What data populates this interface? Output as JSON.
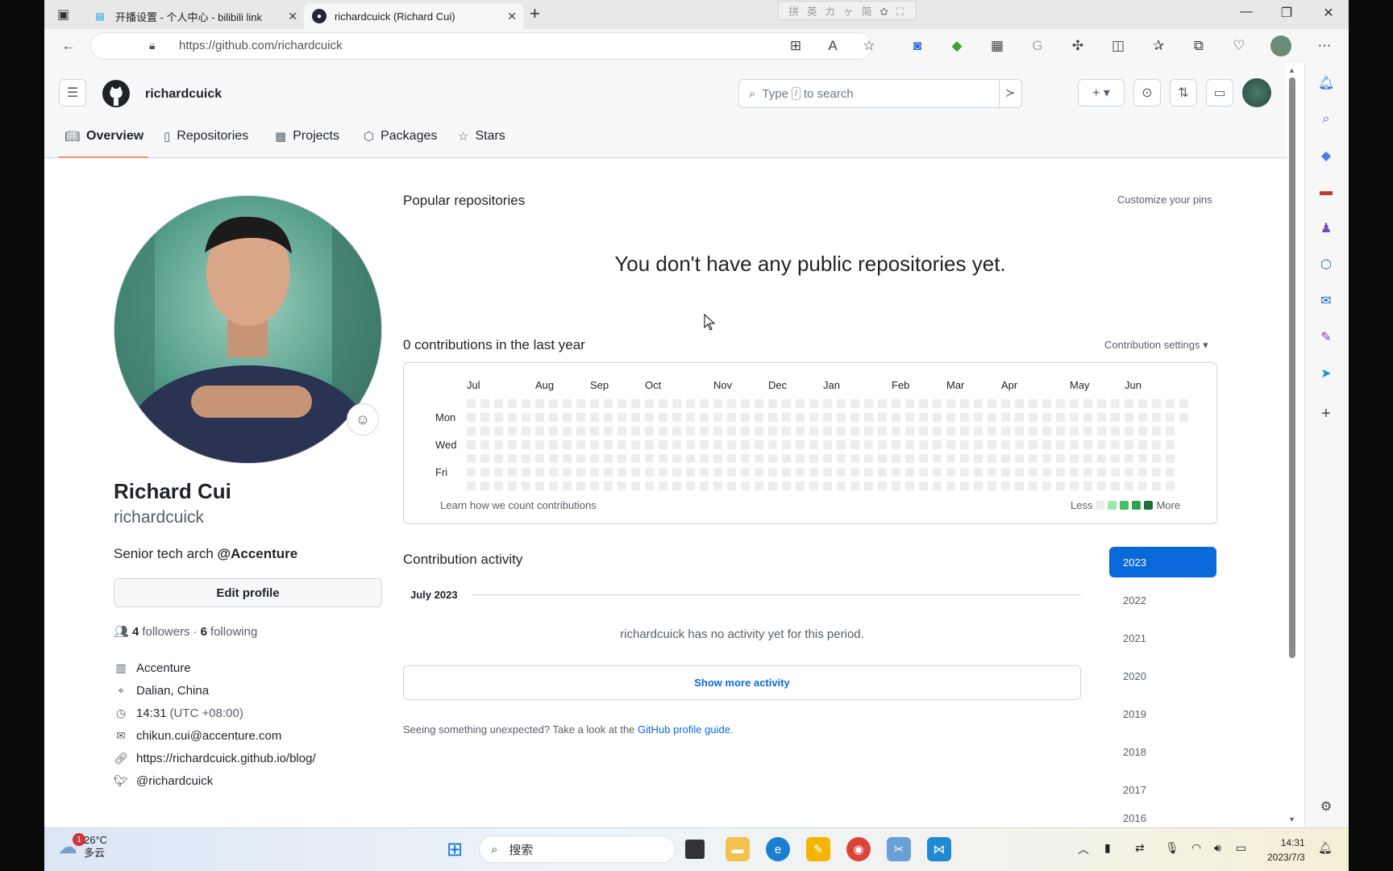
{
  "browser": {
    "tabs": [
      {
        "title": "开播设置 - 个人中心 - bilibili link",
        "icon": "bilibili-icon"
      },
      {
        "title": "richardcuick (Richard Cui)",
        "icon": "github-icon"
      }
    ],
    "ime_text": "拼 英 カ ヶ 简 ✿ ⛶",
    "url": "https://github.com/richardcuick"
  },
  "header": {
    "username": "richardcuick",
    "search_placeholder_pre": "Type",
    "search_key": "/",
    "search_placeholder_post": "to search"
  },
  "nav": {
    "tabs": [
      {
        "label": "Overview",
        "icon": "book-icon"
      },
      {
        "label": "Repositories",
        "icon": "repo-icon"
      },
      {
        "label": "Projects",
        "icon": "table-icon"
      },
      {
        "label": "Packages",
        "icon": "package-icon"
      },
      {
        "label": "Stars",
        "icon": "star-icon"
      }
    ]
  },
  "profile": {
    "full_name": "Richard Cui",
    "login": "richardcuick",
    "bio_prefix": "Senior tech arch ",
    "bio_org": "@Accenture",
    "edit_label": "Edit profile",
    "followers_count": "4",
    "followers_label": "followers",
    "separator": "·",
    "following_count": "6",
    "following_label": "following",
    "company": "Accenture",
    "location": "Dalian, China",
    "time": "14:31",
    "timezone": "(UTC +08:00)",
    "email": "chikun.cui@accenture.com",
    "website": "https://richardcuick.github.io/blog/",
    "twitter": "@richardcuick"
  },
  "popular": {
    "title": "Popular repositories",
    "customize": "Customize your pins",
    "empty": "You don't have any public repositories yet."
  },
  "contributions": {
    "title": "0 contributions in the last year",
    "settings": "Contribution settings ▾",
    "months": [
      "Jul",
      "Aug",
      "Sep",
      "Oct",
      "Nov",
      "Dec",
      "Jan",
      "Feb",
      "Mar",
      "Apr",
      "May",
      "Jun"
    ],
    "days": [
      "Mon",
      "Wed",
      "Fri"
    ],
    "learn": "Learn how we count contributions",
    "less": "Less",
    "more": "More",
    "weeks": 53,
    "total": 0,
    "colors": [
      "#ebedf0",
      "#9be9a8",
      "#40c463",
      "#30a14e",
      "#216e39"
    ]
  },
  "activity": {
    "title": "Contribution activity",
    "month": "July 2023",
    "empty": "richardcuick has no activity yet for this period.",
    "show_more": "Show more activity",
    "unexpected_pre": "Seeing something unexpected? Take a look at the ",
    "guide_link": "GitHub profile guide",
    "unexpected_post": ".",
    "years": [
      "2023",
      "2022",
      "2021",
      "2020",
      "2019",
      "2018",
      "2017",
      "2016"
    ],
    "selected_year": "2023"
  },
  "taskbar": {
    "weather_temp": "26°C",
    "weather_desc": "多云",
    "weather_badge": "1",
    "search_label": "搜索",
    "time": "14:31",
    "date": "2023/7/3"
  },
  "colors": {
    "accent": "#0969da",
    "tab_underline": "#fd8c73",
    "border": "#d0d7de"
  }
}
